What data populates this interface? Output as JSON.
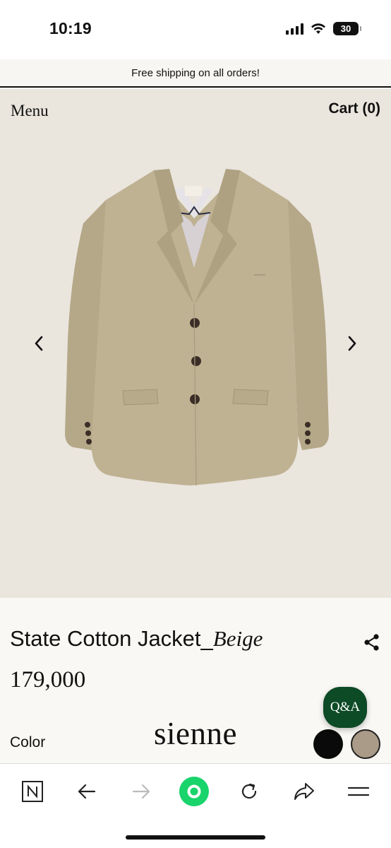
{
  "status_bar": {
    "time": "10:19",
    "battery_level": "30",
    "icons": [
      "signal-icon",
      "wifi-icon",
      "battery-icon"
    ]
  },
  "promo": {
    "text": "Free shipping on all orders!"
  },
  "header": {
    "menu_label": "Menu",
    "cart_label": "Cart (0)"
  },
  "gallery": {
    "prev_icon": "chevron-left-icon",
    "next_icon": "chevron-right-icon",
    "image_label": "sienne"
  },
  "product": {
    "name": "State Cotton Jacket_",
    "variant": "Beige",
    "price": "179,000",
    "color_label": "Color",
    "swatches": [
      {
        "name": "black",
        "hex": "#0a0a0a"
      },
      {
        "name": "beige",
        "hex": "#a99b87"
      }
    ]
  },
  "qa_button": {
    "label": "Q&A",
    "color": "#0d4a26"
  },
  "brand": {
    "logo_text": "sienne"
  },
  "browser_toolbar": {
    "icons": [
      "naver-n-icon",
      "back-arrow-icon",
      "forward-arrow-icon",
      "green-dot-icon",
      "reload-icon",
      "share-arrow-icon",
      "menu-icon"
    ],
    "accent_color": "#19d36b"
  }
}
